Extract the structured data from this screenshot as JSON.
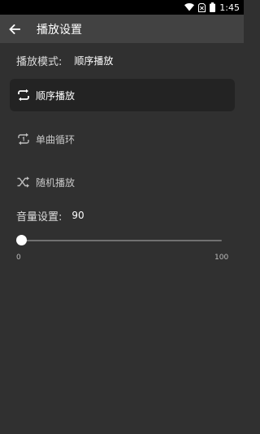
{
  "status_bar": {
    "time": "1:45",
    "icons": [
      "wifi-icon",
      "sim-no-service-icon",
      "battery-icon"
    ]
  },
  "app_bar": {
    "back_icon": "arrow-left-icon",
    "title": "播放设置"
  },
  "play_mode": {
    "label": "播放模式:",
    "value": "顺序播放"
  },
  "options": [
    {
      "label": "顺序播放",
      "icon": "repeat-icon",
      "selected": true
    },
    {
      "label": "单曲循环",
      "icon": "repeat-one-icon",
      "selected": false
    },
    {
      "label": "随机播放",
      "icon": "shuffle-icon",
      "selected": false
    }
  ],
  "volume": {
    "label": "音量设置:",
    "value": "90",
    "min": "0",
    "max": "100"
  },
  "colors": {
    "background": "#303030",
    "app_bar": "#424242",
    "status_bar": "#000000",
    "selected_option": "#232323"
  }
}
